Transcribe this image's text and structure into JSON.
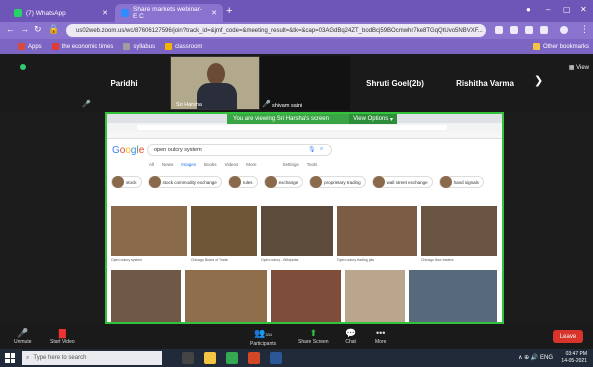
{
  "browser": {
    "tabs": [
      {
        "label": "(7) WhatsApp",
        "favicon_color": "#25d366"
      },
      {
        "label": "Share markets webinar- E C",
        "favicon_color": "#2d8cff"
      }
    ],
    "new_tab_symbol": "+",
    "url": "us02web.zoom.us/wc/87606127596/join?track_id=&jmf_code=&meeting_result=&tk=&cap=03AGdBq24ZT_bodBcj59BOcmwhr7ke8TGqQtUvo5NBVXF...",
    "bookmarks": [
      {
        "label": "Apps",
        "color": "#d94a38"
      },
      {
        "label": "the economic times",
        "color": "#e53935"
      },
      {
        "label": "syllabus",
        "color": "#9e9e9e"
      },
      {
        "label": "classroom",
        "color": "#f4b400"
      }
    ],
    "other_bookmarks": "Other bookmarks"
  },
  "gallery": {
    "participants": [
      "Paridhi",
      "Shruti Goel(2b)",
      "Rishitha Varma"
    ],
    "video_label": "Sri Harsha",
    "muted_label": "shivam saini",
    "view_label": "View"
  },
  "share": {
    "banner_text": "You are viewing Sri Harsha's screen",
    "view_options": "View Options",
    "search_query": "open outcry system",
    "google_letters": [
      "G",
      "o",
      "o",
      "g",
      "l",
      "e"
    ],
    "search_tabs": [
      "All",
      "News",
      "Images",
      "Books",
      "Videos",
      "More",
      "Settings",
      "Tools"
    ],
    "chips": [
      "stock",
      "stock commodity exchange",
      "rules",
      "exchange",
      "proprietary trading",
      "wall street exchange",
      "hand signals",
      "trading places"
    ],
    "captions": [
      "Open outcry system",
      "Chicago Board of Trade",
      "Open outcry - Wikipedia",
      "Open outcry trading pits",
      "Chicago floor traders"
    ]
  },
  "controls": {
    "items": [
      "Unmute",
      "Start Video",
      "Participants",
      "Share Screen",
      "Chat",
      "More"
    ],
    "participants_count": "334",
    "leave_label": "Leave"
  },
  "taskbar": {
    "search_placeholder": "Type here to search",
    "time": "03:47 PM",
    "date": "14-05-2021"
  }
}
